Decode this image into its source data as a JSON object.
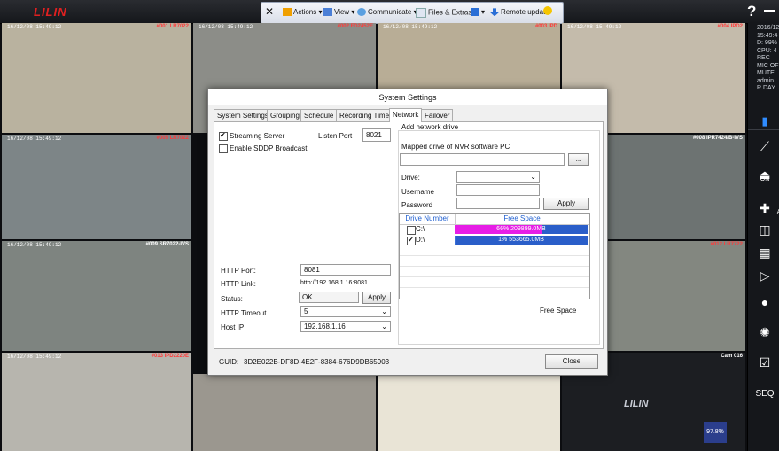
{
  "app": {
    "logo_prefix": "",
    "logo_brand": "LILIN"
  },
  "remote_toolbar": {
    "items": [
      "Actions",
      "View",
      "Communicate",
      "Files & Extras",
      "Remote update"
    ],
    "close_symbol": "✕"
  },
  "cameras": [
    {
      "label": "#001 LR7022",
      "timestamp": "16/12/08 15:49:12",
      "color": "#b9b29f"
    },
    {
      "label": "#002 FD2452E",
      "timestamp": "16/12/08 15:49:12",
      "color": "#8c8d88"
    },
    {
      "label": "#003 IPD",
      "timestamp": "16/12/08 15:49:12",
      "color": "#b8ad96"
    },
    {
      "label": "#004 IPD2",
      "timestamp": "16/12/08 15:49:12",
      "color": "#c4bbab"
    },
    {
      "label": "#005 LR7022",
      "timestamp": "16/12/08 15:49:12",
      "color": "#7d8587"
    },
    {
      "label": "#008 IPR7424/B-IVS",
      "timestamp": "16/12/08 15:49:12",
      "color": "#6d7372"
    },
    {
      "label": "#009 SR7022-IVS",
      "timestamp": "16/12/08 15:49:12",
      "color": "#7e8480"
    },
    {
      "label": "#012 LR7722",
      "timestamp": "16/12/08 15:49:12",
      "color": "#838780"
    },
    {
      "label": "#013 IPD2220E",
      "timestamp": "16/12/08 15:49:12",
      "color": "#b7b5ae"
    },
    {
      "label": "Cam 016",
      "timestamp": "",
      "color": "#1c1e22"
    }
  ],
  "cam016": {
    "brand": "LILIN",
    "percent": "97.8%"
  },
  "sidebar": {
    "info_lines": [
      "2016/12",
      "15:49:4",
      "D: 99%",
      "CPU: 4",
      "REC",
      "MIC OF",
      "MUTE",
      "admin",
      "R DAY"
    ],
    "on_label": "ON",
    "ap_label": "Ap",
    "seq_label": "SEQ"
  },
  "dialog": {
    "title": "System Settings",
    "tabs": [
      "System Settings",
      "Grouping",
      "Schedule",
      "Recording Time",
      "Network",
      "Failover"
    ],
    "active_tab": "Network",
    "streaming_server_label": "Streaming Server",
    "streaming_server_checked": true,
    "listen_port_label": "Listen Port",
    "listen_port_value": "8021",
    "sddp_label": "Enable SDDP Broadcast",
    "sddp_checked": false,
    "add_network_drive_label": "Add network drive",
    "mapped_drive_label": "Mapped drive of NVR software PC",
    "mapped_drive_value": "",
    "browse_label": "...",
    "drive_label": "Drive:",
    "drive_value": "",
    "username_label": "Username",
    "username_value": "",
    "password_label": "Password",
    "password_value": "",
    "apply_label": "Apply",
    "drive_table": {
      "headers": [
        "Drive Number",
        "Free Space"
      ],
      "rows": [
        {
          "drive": "C:\\",
          "checked": false,
          "usage_text": "66%  209899.0MB",
          "fill": 0.66,
          "color": "#e61ee6"
        },
        {
          "drive": "D:\\",
          "checked": true,
          "usage_text": "1%  553665.0MB",
          "fill": 0.01,
          "color": "#3a6fd8"
        }
      ]
    },
    "free_space_label": "Free Space",
    "http_port_label": "HTTP Port:",
    "http_port_value": "8081",
    "http_link_label": "HTTP Link:",
    "http_link_value": "http://192.168.1.16:8081",
    "status_label": "Status:",
    "status_value": "OK",
    "status_apply_label": "Apply",
    "http_timeout_label": "HTTP Timeout",
    "http_timeout_value": "5",
    "host_ip_label": "Host IP",
    "host_ip_value": "192.168.1.16",
    "guid_label": "GUID:",
    "guid_value": "3D2E022B-DF8D-4E2F-8384-676D9DB65903",
    "close_label": "Close"
  }
}
